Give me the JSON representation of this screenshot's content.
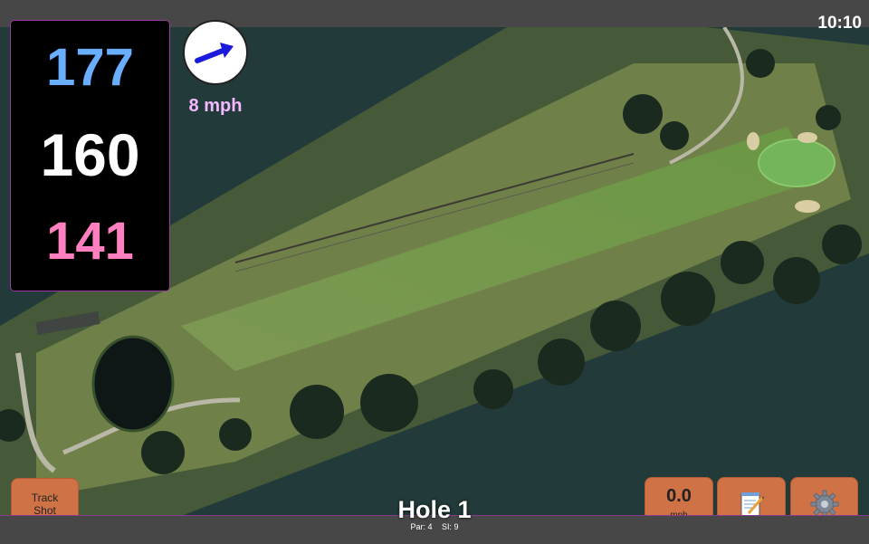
{
  "status": {
    "time": "10:10"
  },
  "distances": {
    "back": "177",
    "middle": "160",
    "front": "141"
  },
  "wind": {
    "speed_label": "8 mph",
    "icon": "wind-direction-arrow-icon"
  },
  "buttons": {
    "track_shot": "Track\nShot",
    "speed_value": "0.0",
    "speed_unit": "mph",
    "notes_icon": "notepad-icon",
    "settings_icon": "gear-icon"
  },
  "hole": {
    "title": "Hole 1",
    "par": "Par: 4",
    "si": "SI: 9"
  },
  "colors": {
    "back_distance": "#6aaeff",
    "middle_distance": "#ffffff",
    "front_distance": "#ff7fc0",
    "button_orange": "#cf7245",
    "accent_border": "#9a3a9a"
  }
}
